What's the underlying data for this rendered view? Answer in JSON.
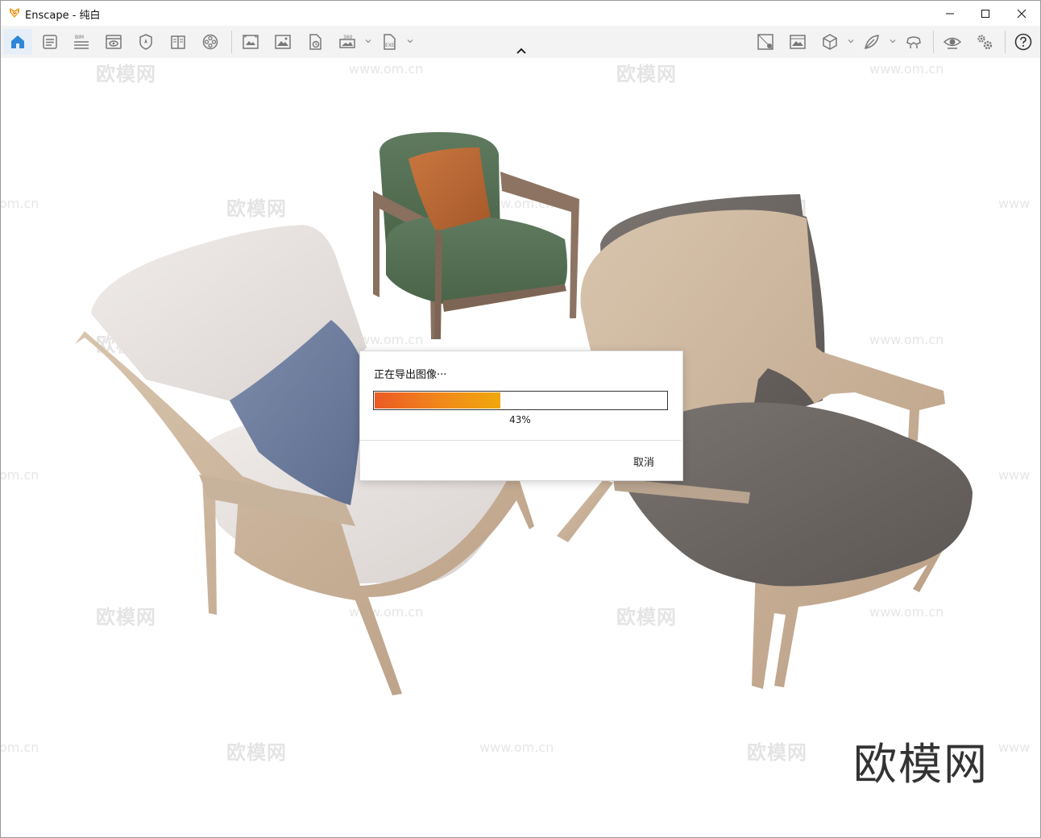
{
  "window": {
    "app_name": "Enscape",
    "title": "Enscape - 纯白"
  },
  "title_controls": [
    {
      "name": "minimize-button",
      "icon": "minimize-icon"
    },
    {
      "name": "maximize-button",
      "icon": "maximize-icon"
    },
    {
      "name": "close-button",
      "icon": "close-icon"
    }
  ],
  "toolbar": {
    "left_buttons": [
      {
        "icon": "home-icon",
        "active": true
      },
      {
        "icon": "properties-icon"
      },
      {
        "icon": "bim-icon",
        "badge": "BIM"
      },
      {
        "icon": "view-icon"
      },
      {
        "icon": "compass-icon"
      },
      {
        "icon": "library-icon"
      },
      {
        "icon": "video-reel-icon"
      },
      {
        "icon": "capture-icon"
      },
      {
        "icon": "screenshot-icon"
      },
      {
        "icon": "batch-render-icon"
      },
      {
        "icon": "panorama-icon",
        "badge": "360"
      },
      {
        "icon": "export-exe-icon",
        "badge": "EXE"
      }
    ],
    "right_buttons": [
      {
        "icon": "material-editor-icon"
      },
      {
        "icon": "atmosphere-icon"
      },
      {
        "icon": "cube-icon"
      },
      {
        "icon": "asset-leaf-icon"
      },
      {
        "icon": "vr-headset-icon"
      },
      {
        "icon": "eye-icon"
      },
      {
        "icon": "settings-gears-icon"
      },
      {
        "icon": "help-icon"
      }
    ]
  },
  "watermarks": {
    "logo_text": "欧模网",
    "url_text": "www.om.cn",
    "partial_url": "om.cn",
    "partial_url_left": "www"
  },
  "brand_mark": "欧模网",
  "export_dialog": {
    "title": "正在导出图像···",
    "progress": 0.43,
    "progress_label": "43%",
    "cancel_label": "取消",
    "progress_colors": [
      "#ec5a24",
      "#f0a70c"
    ]
  }
}
